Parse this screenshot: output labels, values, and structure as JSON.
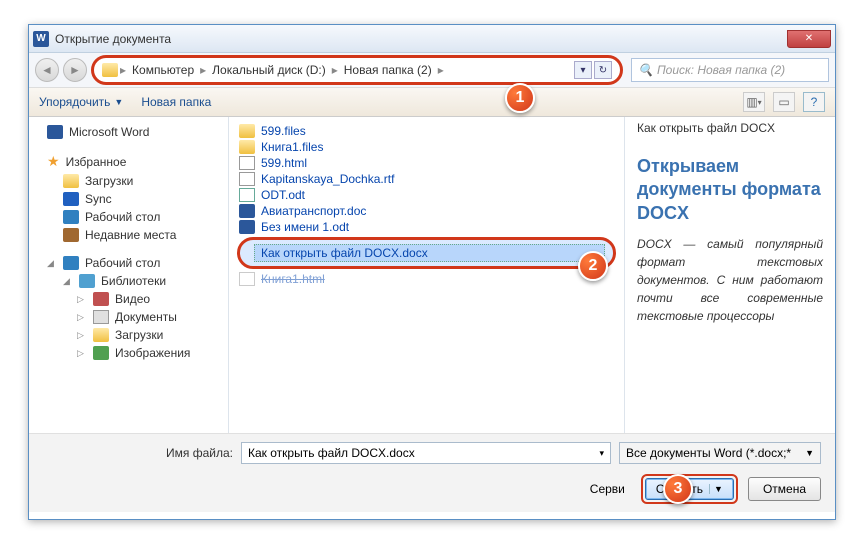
{
  "title": "Открытие документа",
  "markers": {
    "m1": "1",
    "m2": "2",
    "m3": "3"
  },
  "breadcrumbs": [
    "Компьютер",
    "Локальный диск (D:)",
    "Новая папка (2)"
  ],
  "search_placeholder": "Поиск: Новая папка (2)",
  "toolbar": {
    "organize": "Упорядочить",
    "newfolder": "Новая папка"
  },
  "nav": {
    "word": "Microsoft Word",
    "fav_header": "Избранное",
    "fav": [
      "Загрузки",
      "Sync",
      "Рабочий стол",
      "Недавние места"
    ],
    "desk_header": "Рабочий стол",
    "libs_header": "Библиотеки",
    "libs": [
      "Видео",
      "Документы",
      "Загрузки",
      "Изображения"
    ]
  },
  "files": [
    {
      "name": "599.files",
      "type": "folder"
    },
    {
      "name": "Книга1.files",
      "type": "folder"
    },
    {
      "name": "599.html",
      "type": "html"
    },
    {
      "name": "Kapitanskaya_Dochka.rtf",
      "type": "rtf"
    },
    {
      "name": "ODT.odt",
      "type": "odt"
    },
    {
      "name": "Авиатранспорт.doc",
      "type": "doc"
    },
    {
      "name": "Без имени 1.odt",
      "type": "odt"
    }
  ],
  "selected_file": "Как открыть файл DOCX.docx",
  "file_after": "Книга1.html",
  "preview": {
    "title": "Как открыть файл DOCX",
    "heading": "Открываем документы формата DOCX",
    "body": "DOCX — самый популярный формат текстовых документов. С ним работают почти все современные текстовые процессоры"
  },
  "footer": {
    "filename_label": "Имя файла:",
    "filename_value": "Как открыть файл DOCX.docx",
    "filetype": "Все документы Word (*.docx;*",
    "service": "Серви",
    "open": "Открыть",
    "cancel": "Отмена"
  }
}
